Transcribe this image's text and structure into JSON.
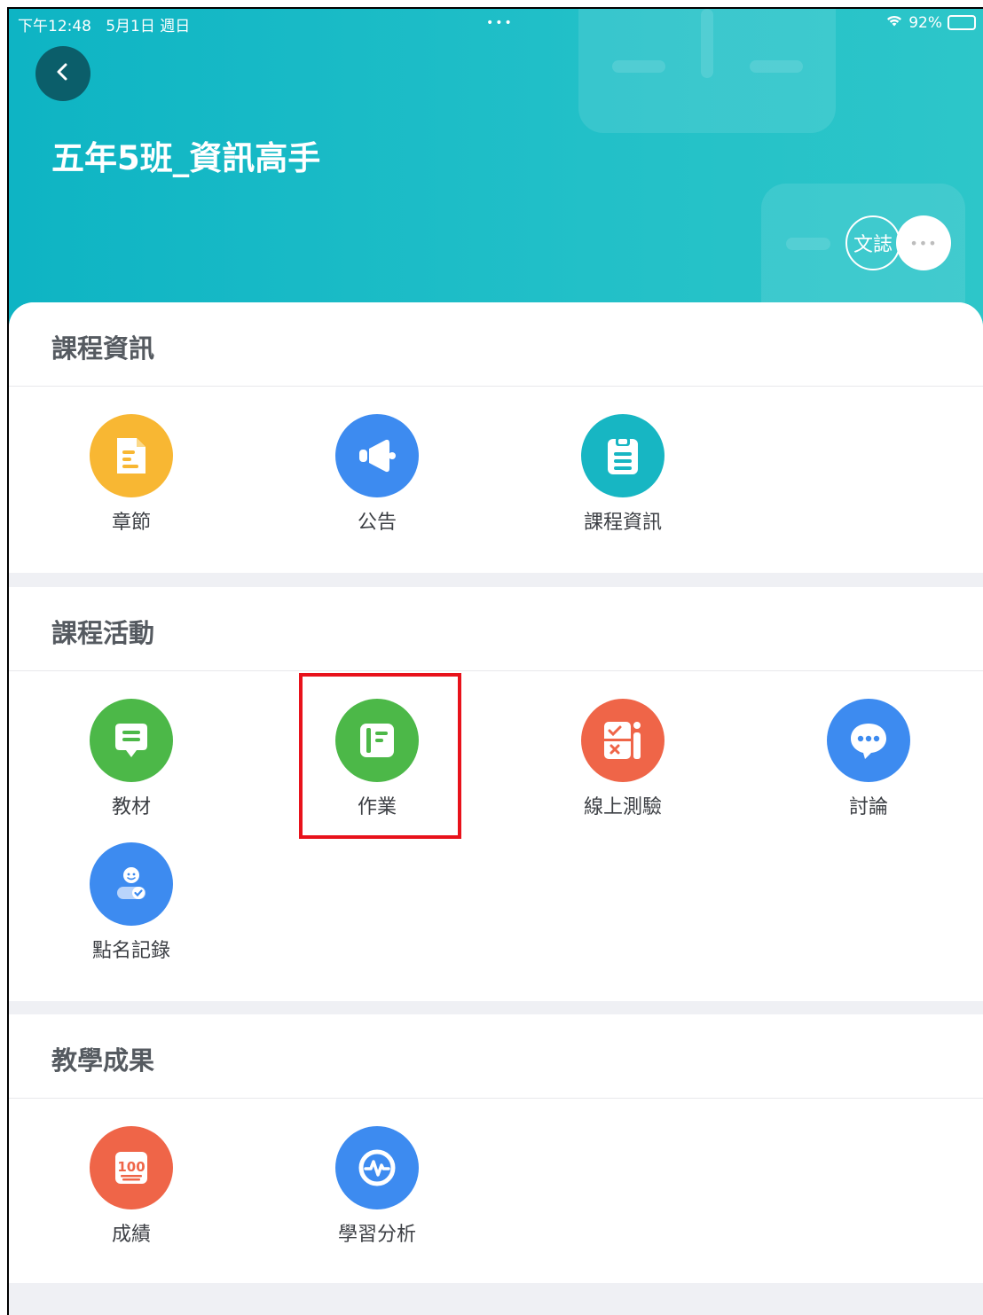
{
  "status_bar": {
    "time": "下午12:48",
    "date": "5月1日 週日",
    "dots": "•••",
    "battery": "92%"
  },
  "header": {
    "title": "五年5班_資訊高手",
    "wen_label": "文誌",
    "more_label": "•••"
  },
  "sections": {
    "course_info": {
      "title": "課程資訊",
      "items": [
        {
          "label": "章節",
          "icon": "document-icon",
          "color": "#f8b733"
        },
        {
          "label": "公告",
          "icon": "megaphone-icon",
          "color": "#3d8bf0"
        },
        {
          "label": "課程資訊",
          "icon": "clipboard-icon",
          "color": "#17b6c3"
        }
      ]
    },
    "course_activity": {
      "title": "課程活動",
      "items": [
        {
          "label": "教材",
          "icon": "material-icon",
          "color": "#4cb848"
        },
        {
          "label": "作業",
          "icon": "assignment-icon",
          "color": "#4cb848"
        },
        {
          "label": "線上測驗",
          "icon": "quiz-icon",
          "color": "#ef6548"
        },
        {
          "label": "討論",
          "icon": "chat-icon",
          "color": "#3d8bf0"
        },
        {
          "label": "點名記錄",
          "icon": "attendance-icon",
          "color": "#3d8bf0"
        }
      ]
    },
    "teaching_results": {
      "title": "教學成果",
      "items": [
        {
          "label": "成績",
          "icon": "score-100-icon",
          "color": "#ef6548"
        },
        {
          "label": "學習分析",
          "icon": "analytics-icon",
          "color": "#3d8bf0"
        }
      ]
    }
  },
  "highlight_color": "#e8121b"
}
